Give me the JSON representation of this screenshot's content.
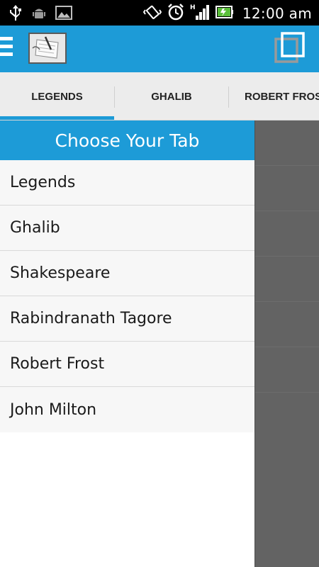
{
  "status_bar": {
    "time": "12:00 am"
  },
  "tabs": [
    {
      "label": "LEGENDS"
    },
    {
      "label": "GHALIB"
    },
    {
      "label": "ROBERT FROST"
    }
  ],
  "drawer": {
    "title": "Choose Your Tab",
    "items": [
      {
        "label": "Legends"
      },
      {
        "label": "Ghalib"
      },
      {
        "label": "Shakespeare"
      },
      {
        "label": "Rabindranath Tagore"
      },
      {
        "label": "Robert Frost"
      },
      {
        "label": "John Milton"
      }
    ]
  },
  "colors": {
    "accent": "#1d9bd7",
    "status_bar": "#000000",
    "scrim": "#636363",
    "tab_strip": "#ececec"
  },
  "icons": {
    "status": [
      "usb-icon",
      "android-debug-icon",
      "image-icon",
      "vibrate-icon",
      "alarm-icon",
      "signal-icon",
      "battery-icon"
    ],
    "action_bar": [
      "hamburger-menu-icon",
      "app-logo-icon",
      "tabs-overview-icon"
    ]
  }
}
